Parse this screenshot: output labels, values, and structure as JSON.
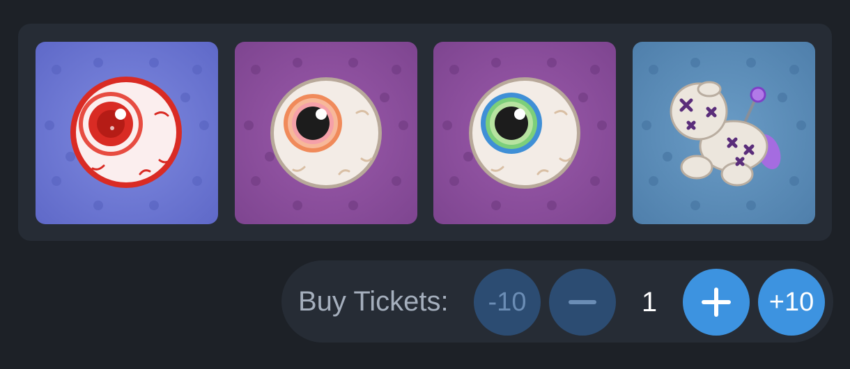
{
  "items": [
    {
      "name": "red-eyeball-icon",
      "background": "#6c77d4"
    },
    {
      "name": "orange-eyeball-icon",
      "background": "#8a4f9a"
    },
    {
      "name": "green-eyeball-icon",
      "background": "#8a4f9a"
    },
    {
      "name": "voodoo-doll-icon",
      "background": "#5b8bb6"
    }
  ],
  "tickets": {
    "label": "Buy Tickets:",
    "minus_ten_label": "-10",
    "quantity": "1",
    "plus_ten_label": "+10"
  },
  "colors": {
    "page_bg": "#1d2127",
    "panel_bg": "#262c35",
    "button_active": "#3d93e0",
    "button_disabled": "#2c4c72"
  }
}
